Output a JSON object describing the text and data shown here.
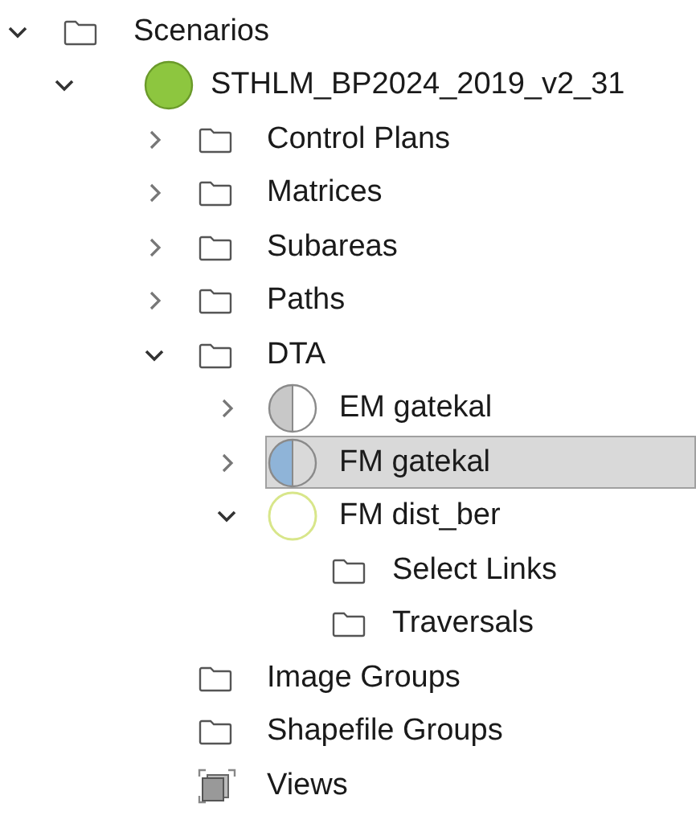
{
  "tree": [
    {
      "label": "Scenarios",
      "kind": "folder",
      "expanded": true,
      "selected": false,
      "children": [
        {
          "label": "STHLM_BP2024_2019_v2_31",
          "kind": "scenario",
          "color": "#8dc63f",
          "expanded": true,
          "selected": false,
          "children": [
            {
              "label": "Control Plans",
              "kind": "folder",
              "expanded": false,
              "selected": false
            },
            {
              "label": "Matrices",
              "kind": "folder",
              "expanded": false,
              "selected": false
            },
            {
              "label": "Subareas",
              "kind": "folder",
              "expanded": false,
              "selected": false
            },
            {
              "label": "Paths",
              "kind": "folder",
              "expanded": false,
              "selected": false
            },
            {
              "label": "DTA",
              "kind": "folder",
              "expanded": true,
              "selected": false,
              "children": [
                {
                  "label": "EM gatekal",
                  "kind": "half",
                  "color": "#c8c8c8",
                  "expanded": false,
                  "selected": false
                },
                {
                  "label": "FM gatekal",
                  "kind": "half",
                  "color": "#8fb4d8",
                  "expanded": false,
                  "selected": true
                },
                {
                  "label": "FM dist_ber",
                  "kind": "ring",
                  "color": "#d8e68a",
                  "expanded": true,
                  "selected": false,
                  "children": [
                    {
                      "label": "Select Links",
                      "kind": "folder",
                      "selected": false
                    },
                    {
                      "label": "Traversals",
                      "kind": "folder",
                      "selected": false
                    }
                  ]
                }
              ]
            },
            {
              "label": "Image Groups",
              "kind": "folder",
              "selected": false
            },
            {
              "label": "Shapefile Groups",
              "kind": "folder",
              "selected": false
            },
            {
              "label": "Views",
              "kind": "views",
              "selected": false
            }
          ]
        }
      ]
    }
  ]
}
